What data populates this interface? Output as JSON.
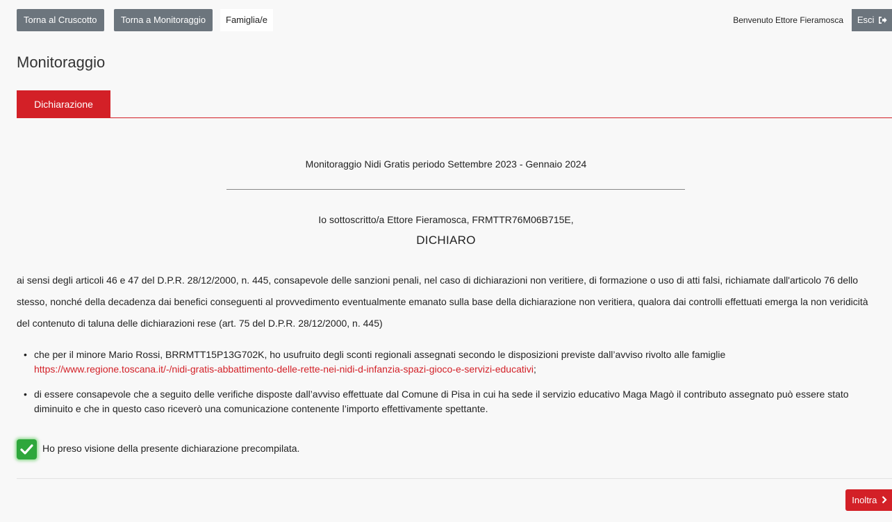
{
  "topbar": {
    "btn_dashboard": "Torna al Cruscotto",
    "btn_monitoring": "Torna a Monitoraggio",
    "family_label": "Famiglia/e",
    "welcome": "Benvenuto Ettore Fieramosca",
    "logout": "Esci"
  },
  "page": {
    "title": "Monitoraggio",
    "tab": "Dichiarazione"
  },
  "declaration": {
    "period": "Monitoraggio Nidi Gratis periodo Settembre 2023 - Gennaio 2024",
    "signed": "Io sottoscritto/a Ettore Fieramosca, FRMTTR76M06B715E,",
    "declare": "DICHIARO",
    "paragraph": "ai sensi degli articoli 46 e 47 del D.P.R. 28/12/2000, n. 445, consapevole delle sanzioni penali, nel caso di dichiarazioni non veritiere, di formazione o uso di atti falsi, richiamate dall'articolo 76 dello stesso, nonché della decadenza dai benefici conseguenti al provvedimento eventualmente emanato sulla base della dichiarazione non veritiera, qualora dai controlli effettuati emerga la non veridicità del contenuto di taluna delle dichiarazioni rese (art. 75 del D.P.R. 28/12/2000, n. 445)",
    "bullet1_text": "che per il minore Mario Rossi, BRRMTT15P13G702K, ho usufruito degli sconti regionali assegnati secondo le disposizioni previste dall’avviso rivolto alle famiglie",
    "bullet1_link": "https://www.regione.toscana.it/-/nidi-gratis-abbattimento-delle-rette-nei-nidi-d-infanzia-spazi-gioco-e-servizi-educativi",
    "bullet1_suffix": ";",
    "bullet2_text": "di essere consapevole che a seguito delle verifiche disposte dall’avviso effettuate dal Comune di Pisa in cui ha sede il servizio educativo Maga Magò il contributo assegnato può essere stato diminuito e che in questo caso riceverò una comunicazione contenente l’importo effettivamente spettante."
  },
  "confirm": {
    "checked": true,
    "label": "Ho preso visione della presente dichiarazione precompilata."
  },
  "actions": {
    "submit": "Inoltra"
  },
  "colors": {
    "accent": "#d32027",
    "button_gray": "#6c757d",
    "check_green": "#2ea73c"
  },
  "icons": [
    "logout-icon",
    "check-icon",
    "chevron-right-icon"
  ]
}
